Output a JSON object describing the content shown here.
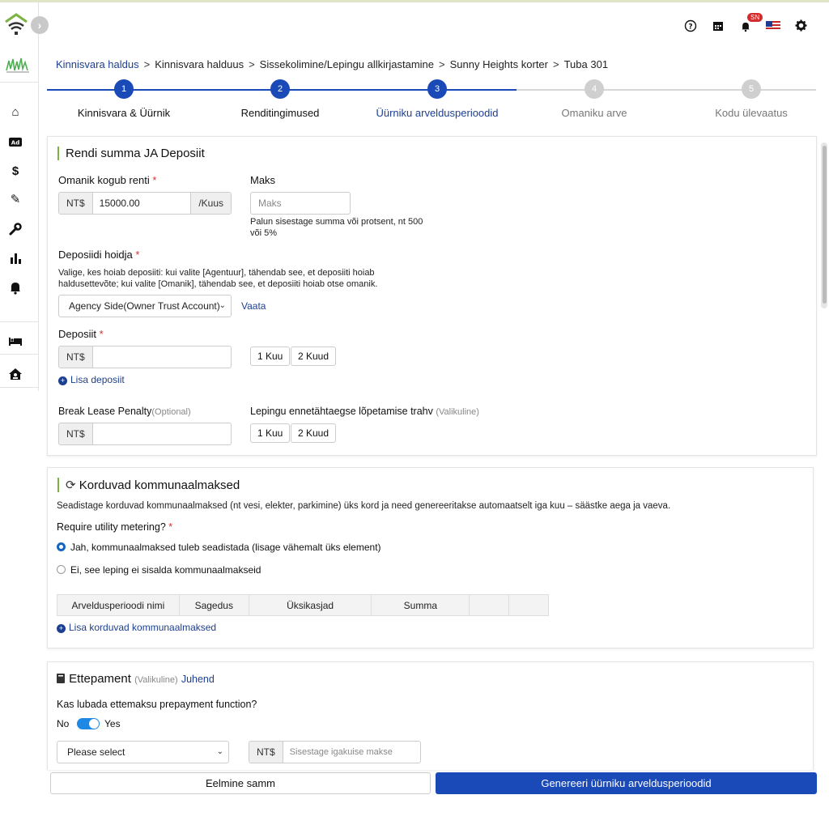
{
  "header": {
    "icons": [
      "help-icon",
      "calendar-icon",
      "bell-icon",
      "flag-icon",
      "gear-icon"
    ],
    "notification_badge": "SN"
  },
  "breadcrumb": {
    "items": [
      "Kinnisvara haldus",
      "Kinnisvara halduus",
      "Sissekolimine/Lepingu allkirjastamine",
      "Sunny Heights korter",
      "Tuba 301"
    ],
    "separator": ">"
  },
  "stepper": {
    "current": 3,
    "active_color": "#1a49b8",
    "inactive_color": "#cfcfcf",
    "steps": [
      {
        "num": "1",
        "label": "Kinnisvara & Üürnik"
      },
      {
        "num": "2",
        "label": "Renditingimused"
      },
      {
        "num": "3",
        "label": "Üürniku arveldusperioodid"
      },
      {
        "num": "4",
        "label": "Omaniku arve"
      },
      {
        "num": "5",
        "label": "Kodu ülevaatus"
      }
    ]
  },
  "rent_deposit": {
    "title": "Rendi summa JA Deposiit",
    "rent_label": "Omanik kogub renti",
    "rent_prefix": "NT$",
    "rent_value": "15000.00",
    "rent_suffix": "/Kuus",
    "max_label": "Maks",
    "max_placeholder": "Maks",
    "max_help": "Palun sisestage summa või protsent, nt 500 või 5%",
    "holder_label": "Deposiidi hoidja",
    "holder_help": "Valige, kes hoiab deposiiti: kui valite [Agentuur], tähendab see, et deposiiti hoiab haldusettevõte; kui valite [Omanik], tähendab see, et deposiiti hoiab otse omanik.",
    "holder_selected": "Agency Side(Owner Trust Account)",
    "holder_view_link": "Vaata",
    "deposit_label": "Deposiit",
    "deposit_prefix": "NT$",
    "deposit_value": "",
    "month1": "1 Kuu",
    "month2": "2 Kuud",
    "add_deposit": "Lisa deposiit",
    "penalty_label": "Break Lease Penalty",
    "penalty_optional": "(Optional)",
    "penalty_prefix": "NT$",
    "penalty_value": "",
    "early_label": "Lepingu ennetähtaegse lõpetamise trahv",
    "early_optional": "(Valikuline)"
  },
  "utilities": {
    "title": "Korduvad kommunaalmaksed",
    "description": "Seadistage korduvad kommunaalmaksed (nt vesi, elekter, parkimine) üks kord ja need genereeritakse automaatselt iga kuu – säästke aega ja vaeva.",
    "metering_label": "Require utility metering?",
    "option_yes": "Jah, kommunaalmaksed tuleb seadistada (lisage vähemalt üks element)",
    "option_no": "Ei, see leping ei sisalda kommunaalmakseid",
    "selected": "yes",
    "columns": [
      "Arveldusperioodi nimi",
      "Sagedus",
      "Üksikasjad",
      "Summa",
      "",
      ""
    ],
    "add_link": "Lisa korduvad kommunaalmaksed"
  },
  "prepayment": {
    "title": "Ettepament",
    "optional": "(Valikuline)",
    "guide_link": "Juhend",
    "question": "Kas lubada ettemaksu prepayment function?",
    "toggle_no": "No",
    "toggle_yes": "Yes",
    "toggle_on": true,
    "select_placeholder": "Please select",
    "amount_prefix": "NT$",
    "amount_placeholder": "Sisestage igakuise makse summa"
  },
  "footer": {
    "prev_label": "Eelmine samm",
    "next_label": "Genereeri üürniku arveldusperioodid",
    "primary_color": "#1a49b8"
  }
}
